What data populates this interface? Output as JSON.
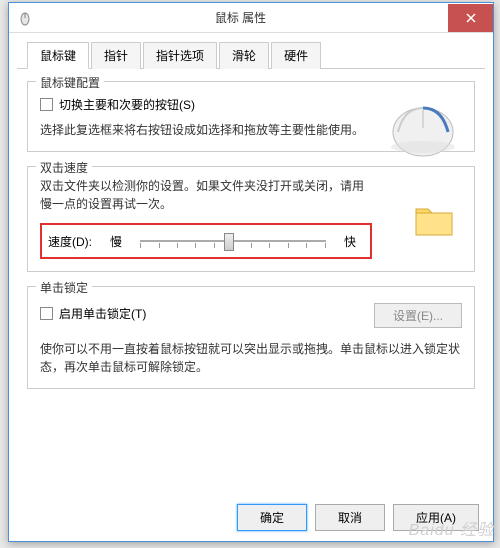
{
  "titlebar": {
    "title": "鼠标 属性"
  },
  "tabs": [
    {
      "label": "鼠标键",
      "active": true
    },
    {
      "label": "指针"
    },
    {
      "label": "指针选项"
    },
    {
      "label": "滑轮"
    },
    {
      "label": "硬件"
    }
  ],
  "group_buttons": {
    "title": "鼠标键配置",
    "checkbox_label": "切换主要和次要的按钮(S)",
    "desc": "选择此复选框来将右按钮设成如选择和拖放等主要性能使用。"
  },
  "group_speed": {
    "title": "双击速度",
    "desc": "双击文件夹以检测你的设置。如果文件夹没打开或关闭，请用慢一点的设置再试一次。",
    "speed_label": "速度(D):",
    "slow": "慢",
    "fast": "快"
  },
  "group_lock": {
    "title": "单击锁定",
    "checkbox_label": "启用单击锁定(T)",
    "settings_button": "设置(E)...",
    "desc": "使你可以不用一直按着鼠标按钮就可以突出显示或拖拽。单击鼠标以进入锁定状态，再次单击鼠标可解除锁定。"
  },
  "buttons": {
    "ok": "确定",
    "cancel": "取消",
    "apply": "应用(A)"
  },
  "watermark": "Baidu 经验"
}
